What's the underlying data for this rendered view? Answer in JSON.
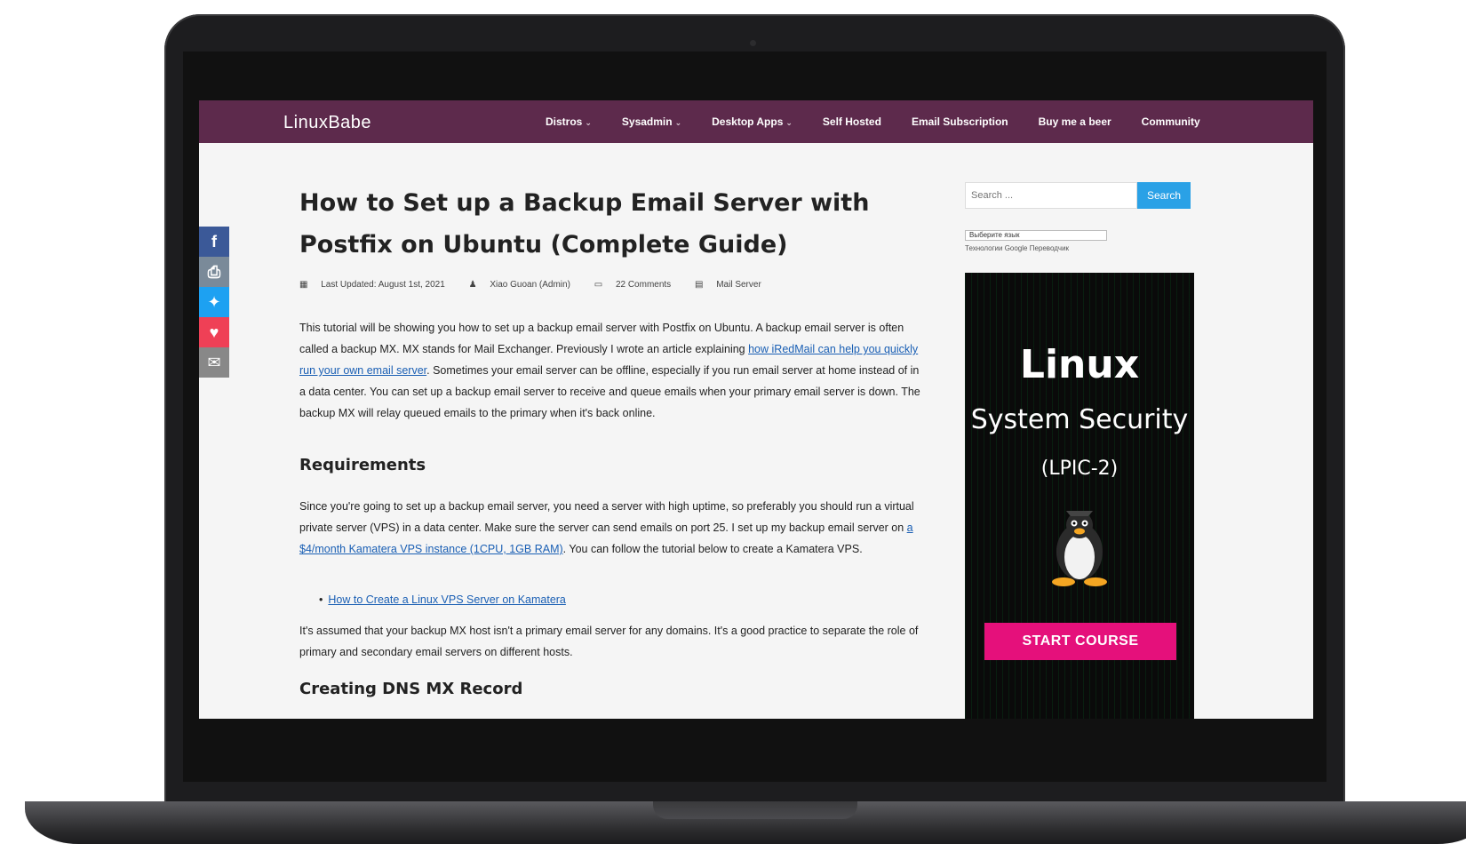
{
  "site": {
    "logo": "LinuxBabe",
    "nav": [
      {
        "label": "Distros",
        "caret": true
      },
      {
        "label": "Sysadmin",
        "caret": true
      },
      {
        "label": "Desktop Apps",
        "caret": true
      },
      {
        "label": "Self Hosted",
        "caret": false
      },
      {
        "label": "Email Subscription",
        "caret": false
      },
      {
        "label": "Buy me a beer",
        "caret": false
      },
      {
        "label": "Community",
        "caret": false
      }
    ]
  },
  "share": [
    {
      "name": "facebook",
      "glyph": "f",
      "color": "#3b5998"
    },
    {
      "name": "print",
      "glyph": "⎙",
      "color": "#7a8a99"
    },
    {
      "name": "twitter",
      "glyph": "✦",
      "color": "#1da1f2"
    },
    {
      "name": "pocket",
      "glyph": "♥",
      "color": "#ef4056"
    },
    {
      "name": "email",
      "glyph": "✉",
      "color": "#888888"
    }
  ],
  "article": {
    "title": "How to Set up a Backup Email Server with Postfix on Ubuntu (Complete Guide)",
    "meta": {
      "updated": "Last Updated: August 1st, 2021",
      "author": "Xiao Guoan (Admin)",
      "comments": "22 Comments",
      "category": "Mail Server"
    },
    "p1_a": "This tutorial will be showing you how to set up a backup email server with Postfix on Ubuntu. A backup email server is often called a backup MX. MX stands for Mail Exchanger. Previously I wrote an article explaining ",
    "p1_link": "how iRedMail can help you quickly run your own email server",
    "p1_b": ". Sometimes your email server can be offline, especially if you run email server at home instead of in a data center. You can set up a backup email server to receive and queue emails when your primary email server is down. The backup MX will relay queued emails to the primary when it's back online.",
    "h_requirements": "Requirements",
    "p2_a": "Since you're going to set up a backup email server, you need a server with high uptime, so preferably you should run a virtual private server (VPS) in a data center. Make sure the server can send emails on port 25. I set up my backup email server on ",
    "p2_link": "a $4/month Kamatera VPS instance (1CPU, 1GB RAM)",
    "p2_b": ". You can follow the tutorial below to create a Kamatera VPS.",
    "bullet": "How to Create a Linux VPS Server on Kamatera",
    "p3": "It's assumed that your backup MX host isn't a primary email server for any domains. It's a good practice to separate the role of primary and secondary email servers on different hosts.",
    "h_dns": "Creating DNS MX Record"
  },
  "sidebar": {
    "search_placeholder": "Search ...",
    "search_button": "Search",
    "translate_select": "Выберите язык",
    "translate_note": "Технологии Google Переводчик",
    "ad": {
      "line1": "Linux",
      "line2": "System Security",
      "line3": "(LPIC-2)",
      "button": "START COURSE"
    }
  }
}
